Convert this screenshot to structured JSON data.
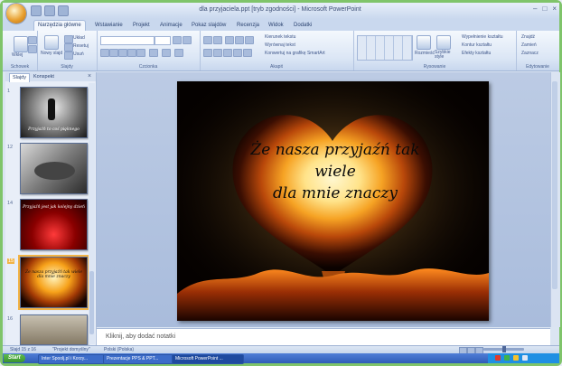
{
  "window": {
    "title": "dla przyjaciela.ppt [tryb zgodności] - Microsoft PowerPoint",
    "controls": [
      "–",
      "□",
      "×"
    ]
  },
  "ribbon_tabs": [
    "Narzędzia główne",
    "Wstawianie",
    "Projekt",
    "Animacje",
    "Pokaz slajdów",
    "Recenzja",
    "Widok",
    "Dodatki"
  ],
  "ribbon": {
    "groups": [
      "Schowek",
      "Slajdy",
      "Czcionka",
      "Akapit",
      "Rysowanie",
      "Edytowanie"
    ],
    "clipboard": {
      "paste": "Wklej"
    },
    "slides": {
      "new_slide": "Nowy slajd",
      "layout": "Układ",
      "reset": "Resetuj",
      "delete": "Usuń"
    },
    "paragraph": {
      "text_direction": "Kierunek tekstu",
      "align_text": "Wyrównaj tekst",
      "smartart": "Konwertuj na grafikę SmartArt"
    },
    "drawing": {
      "arrange": "Rozmieść",
      "quick_styles": "Szybkie style",
      "fill": "Wypełnienie kształtu",
      "outline": "Kontur kształtu",
      "effects": "Efekty kształtu"
    },
    "editing": {
      "find": "Znajdź",
      "replace": "Zamień",
      "select": "Zaznacz"
    }
  },
  "pane": {
    "tabs": [
      "Slajdy",
      "Konspekt"
    ],
    "close": "×",
    "slides": [
      {
        "num": "1",
        "caption": "Przyjaźń to coś pięknego"
      },
      {
        "num": "12",
        "caption": ""
      },
      {
        "num": "14",
        "caption": "Przyjaźń jest jak kolejny dzień"
      },
      {
        "num": "15",
        "caption": "Że nasza przyjaźń tak wiele dla mnie znaczy"
      },
      {
        "num": "16",
        "caption": ""
      }
    ]
  },
  "slide": {
    "text_line1": "Że nasza przyjaźń tak wiele",
    "text_line2": "dla mnie znaczy"
  },
  "notes": {
    "placeholder": "Kliknij, aby dodać notatki"
  },
  "status": {
    "slide_info": "Slajd 15 z 16",
    "theme": "\"Projekt domyślny\"",
    "language": "Polski (Polska)"
  },
  "taskbar": {
    "start": "Start",
    "tasks": [
      "Inter Spoolj.pl i Korzy...",
      "Prezentacje PPS & PPT...",
      "Microsoft PowerPoint ..."
    ]
  },
  "colors": {
    "accent": "#f2b345",
    "titlebar": "#c9d8ee",
    "taskbar": "#2e5cb8"
  }
}
